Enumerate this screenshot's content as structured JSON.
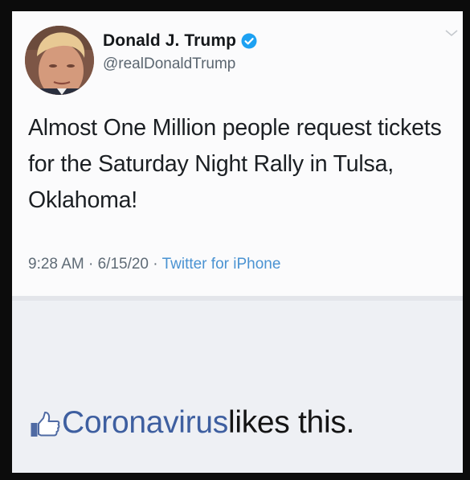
{
  "tweet": {
    "display_name": "Donald J. Trump",
    "handle": "@realDonaldTrump",
    "text": "Almost One Million people request tickets for the Saturday Night Rally in Tulsa, Oklahoma!",
    "time": "9:28 AM",
    "date": "6/15/20",
    "separator": "·",
    "source": "Twitter for iPhone",
    "verified_icon": "verified-badge-icon",
    "options_icon": "chevron-down-icon"
  },
  "like": {
    "icon": "thumbs-up-icon",
    "subject": "Coronavirus",
    "rest": " likes this."
  },
  "colors": {
    "verified_blue": "#1da1f2",
    "source_blue": "#4a93d2",
    "facebook_link": "#3e5fa0"
  }
}
